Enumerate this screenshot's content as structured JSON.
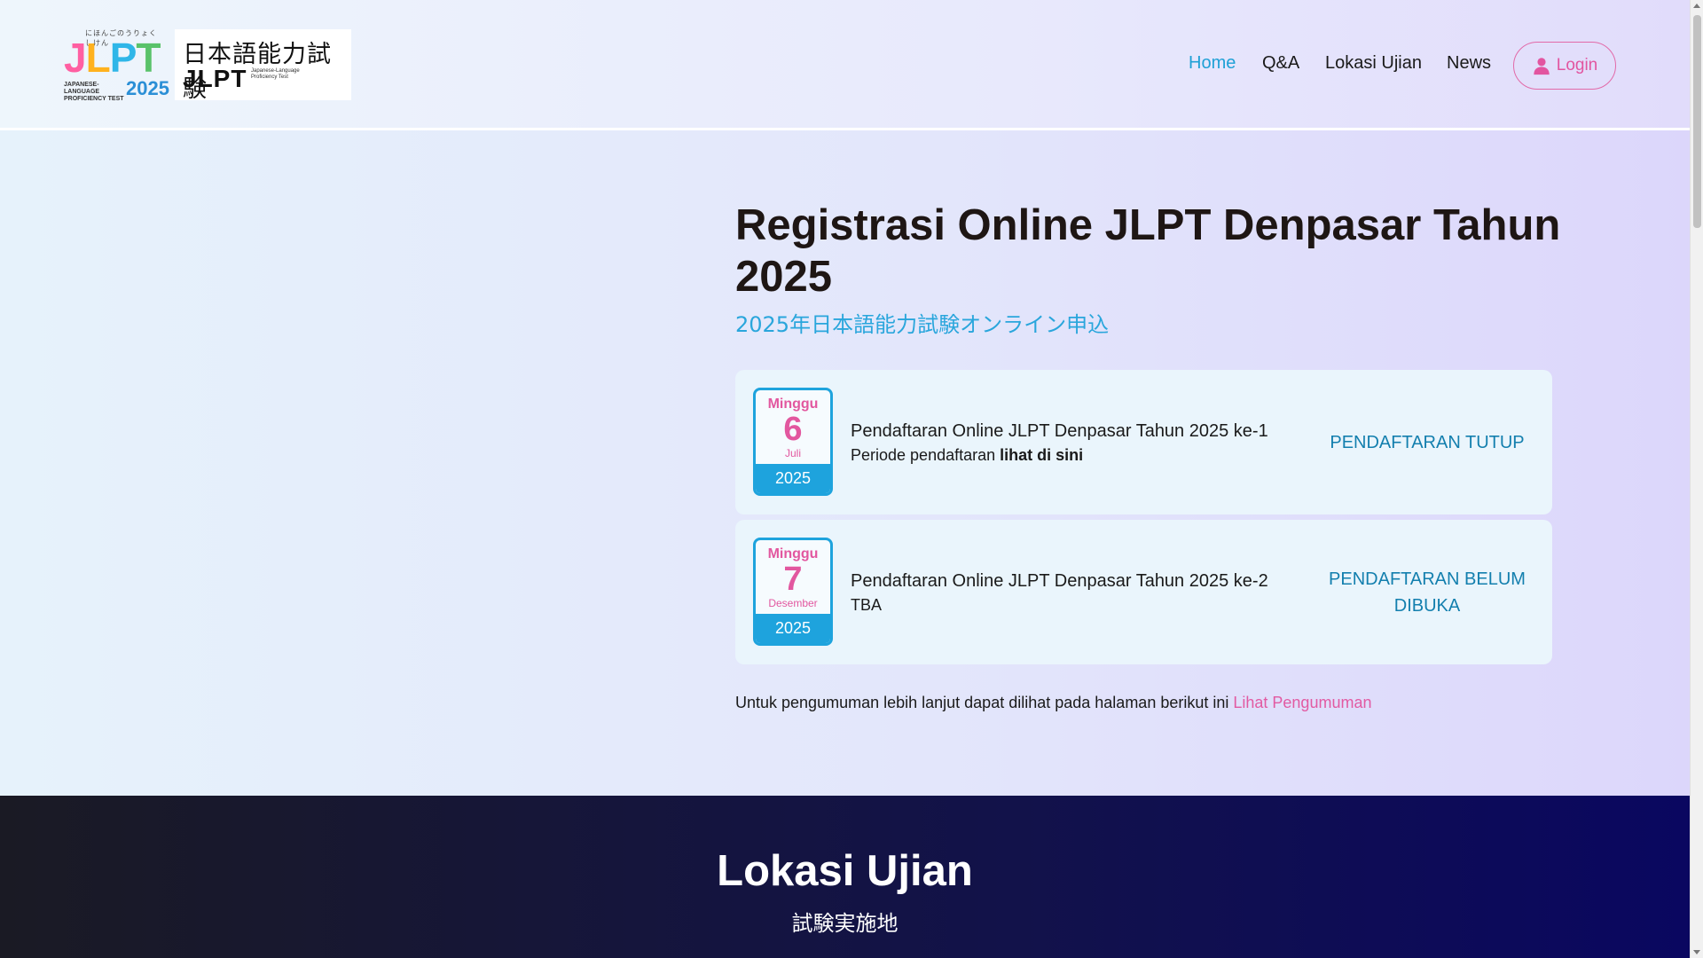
{
  "header": {
    "logo_jlpt": {
      "kana": "にほんごのうりょくしけん",
      "year": "2025",
      "sub": "JAPANESE-LANGUAGE PROFICIENCY TEST"
    },
    "logo_kanji": {
      "line1": "日本語能力試験",
      "line2": "JLPT",
      "desc": "Japanese-Language Proficiency Test"
    },
    "nav": {
      "home": "Home",
      "qa": "Q&A",
      "lokasi": "Lokasi Ujian",
      "news": "News",
      "login": "Login"
    }
  },
  "main": {
    "title": "Registrasi Online JLPT Denpasar Tahun 2025",
    "subtitle": "2025年日本語能力試験オンライン申込",
    "registrations": [
      {
        "day": "Minggu",
        "date": "6",
        "month": "Juli",
        "year": "2025",
        "title": "Pendaftaran Online JLPT Denpasar Tahun 2025 ke-1",
        "sub_prefix": "Periode pendaftaran ",
        "sub_link": "lihat di sini",
        "status": "PENDAFTARAN TUTUP"
      },
      {
        "day": "Minggu",
        "date": "7",
        "month": "Desember",
        "year": "2025",
        "title": "Pendaftaran Online JLPT Denpasar Tahun 2025 ke-2",
        "sub_prefix": "TBA",
        "sub_link": "",
        "status": "PENDAFTARAN BELUM DIBUKA"
      }
    ],
    "note_text": "Untuk pengumuman lebih lanjut dapat dilihat pada halaman berikut ini ",
    "note_link": "Lihat Pengumuman"
  },
  "location_section": {
    "title": "Lokasi Ujian",
    "subtitle": "試験実施地"
  },
  "colors": {
    "accent_blue": "#1ea3dd",
    "accent_pink": "#e2579f",
    "status_text": "#137fae",
    "dark_band": "#12124a"
  },
  "icons": {
    "login": "user-icon"
  }
}
